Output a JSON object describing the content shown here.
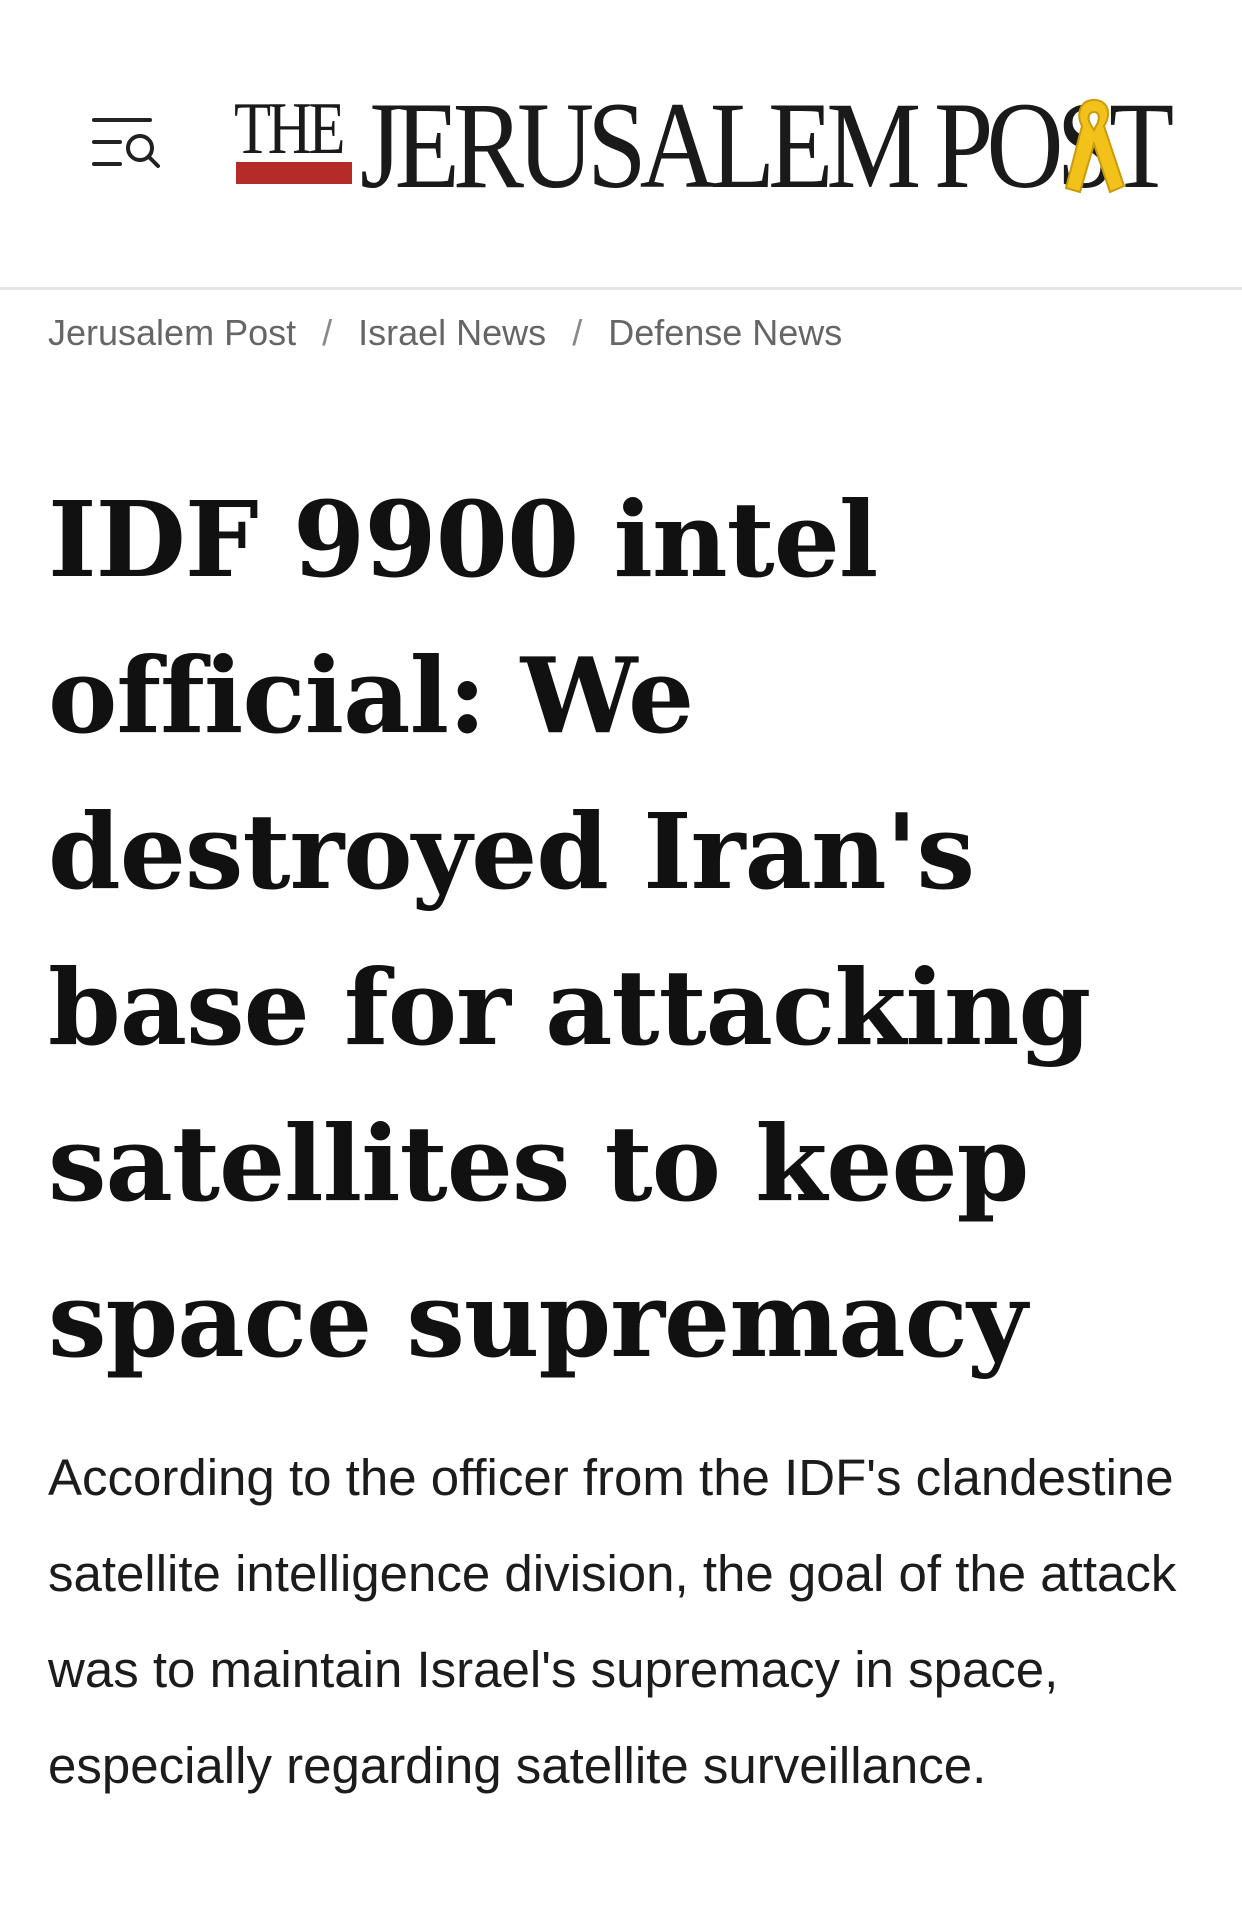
{
  "header": {
    "menu_icon": "menu-search-icon",
    "logo_small": "THE",
    "logo_main": "JERUSALEM POST",
    "logo_ribbon_icon": "yellow-ribbon-icon",
    "logo_bar_color": "#b52b27",
    "ribbon_color": "#f2c21b"
  },
  "breadcrumb": {
    "items": [
      "Jerusalem Post",
      "Israel News",
      "Defense News"
    ],
    "separator": "/"
  },
  "article": {
    "headline": "IDF 9900 intel official: We destroyed Iran's base for attacking satellites to keep space supremacy",
    "subtitle": "According to the officer from the IDF's clandestine satellite intelligence division, the goal of the attack was to maintain Israel's supremacy in space, especially regarding satellite surveillance."
  }
}
